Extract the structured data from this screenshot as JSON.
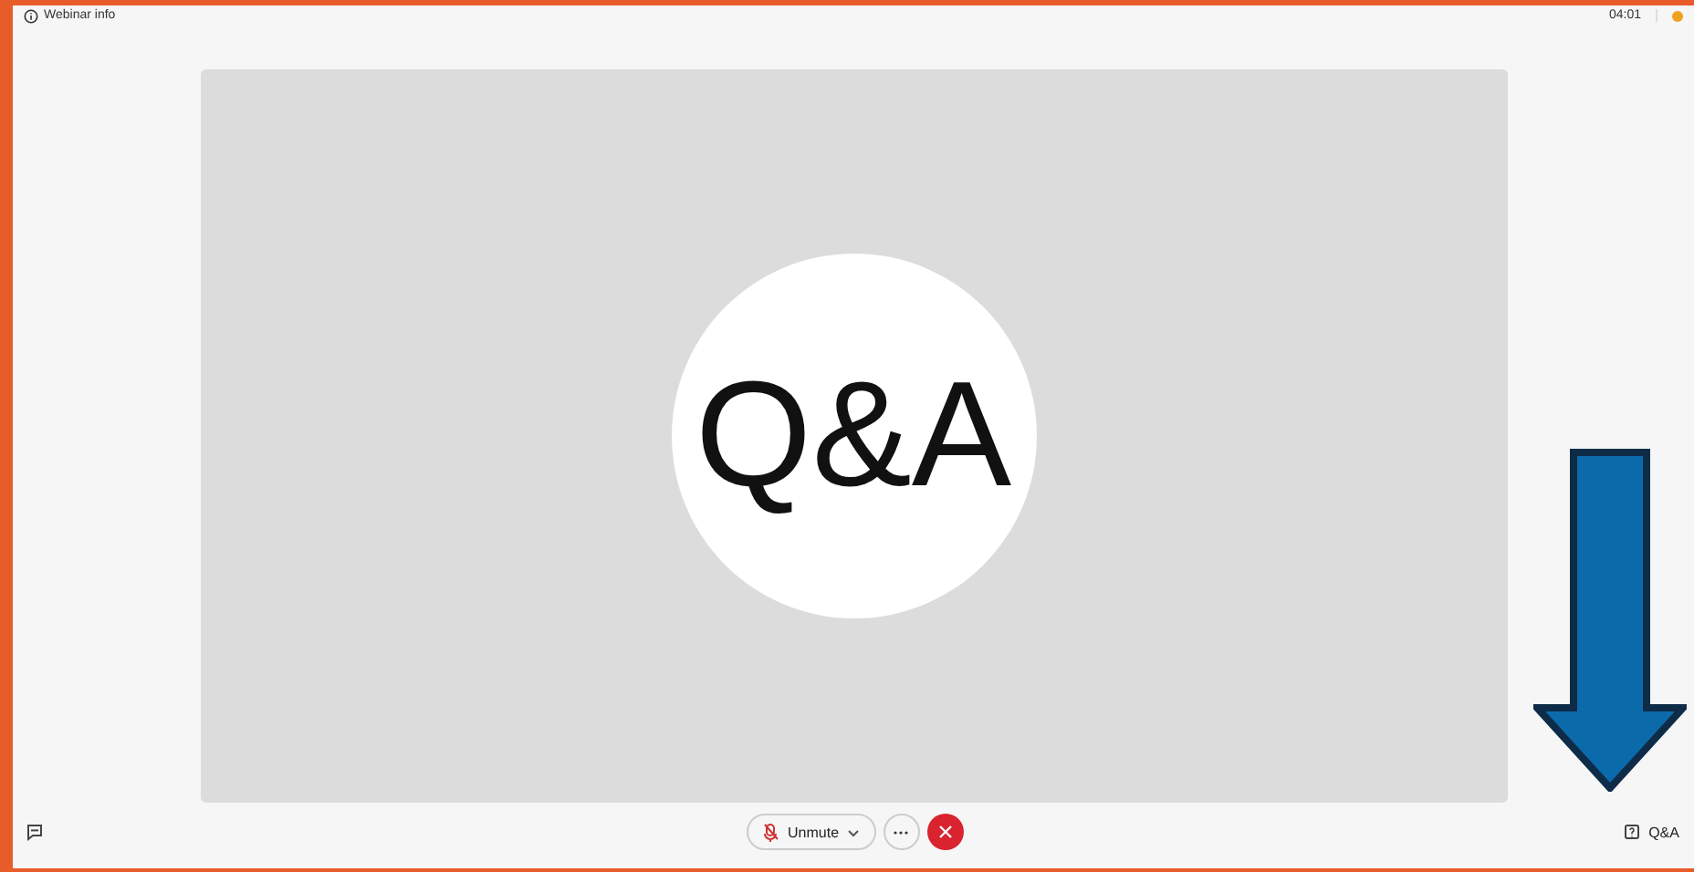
{
  "header": {
    "title": "Webinar info",
    "time": "04:01"
  },
  "stage": {
    "label": "Q&A"
  },
  "controls": {
    "unmute": "Unmute",
    "qa": "Q&A"
  }
}
